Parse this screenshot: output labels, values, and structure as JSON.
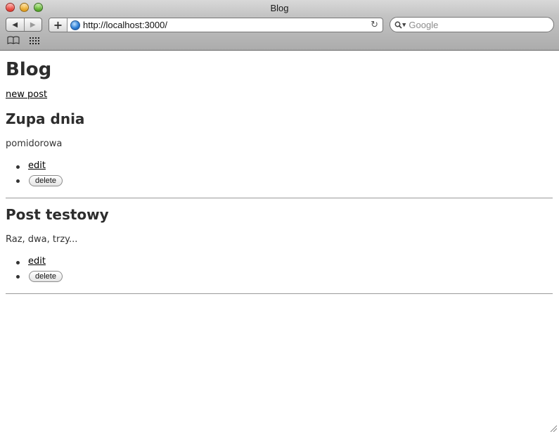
{
  "window": {
    "title": "Blog"
  },
  "toolbar": {
    "address": "http://localhost:3000/",
    "search_placeholder": "Google",
    "back_glyph": "◀",
    "forward_glyph": "▶",
    "add_glyph": "+",
    "reload_glyph": "↻",
    "search_glyph": "🔍",
    "icons": [
      "back-icon",
      "forward-icon",
      "add-bookmark-icon",
      "globe-icon",
      "reload-icon",
      "search-icon",
      "bookmarks-book-icon",
      "top-sites-grid-icon"
    ]
  },
  "page": {
    "heading": "Blog",
    "new_post_link": "new post",
    "posts": [
      {
        "title": "Zupa dnia",
        "body": "pomidorowa",
        "edit_label": "edit",
        "delete_label": "delete"
      },
      {
        "title": "Post testowy",
        "body": "Raz, dwa, trzy...",
        "edit_label": "edit",
        "delete_label": "delete"
      }
    ]
  }
}
